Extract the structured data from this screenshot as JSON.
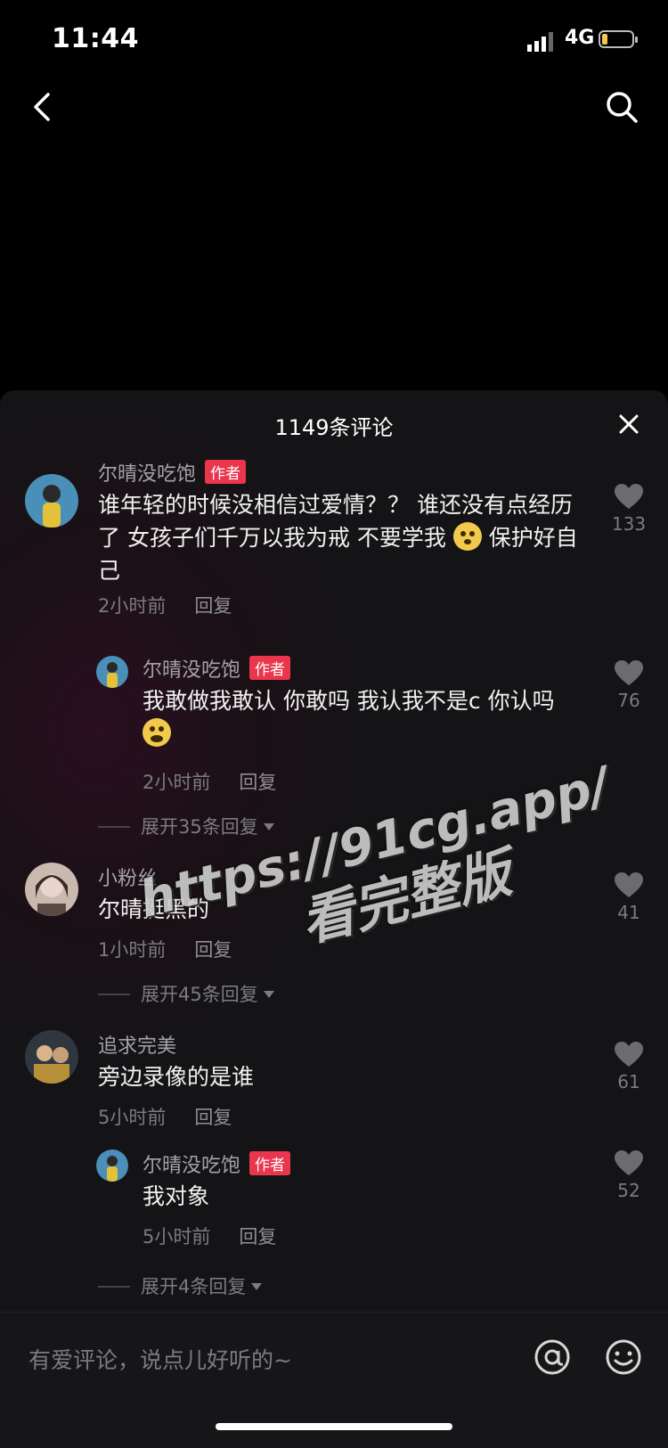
{
  "status": {
    "time": "11:44",
    "network": "4G"
  },
  "header": {
    "back_icon": "chevron-left-icon",
    "search_icon": "search-icon"
  },
  "sheet": {
    "title": "1149条评论",
    "close_icon": "close-icon"
  },
  "comments": [
    {
      "user": "尔晴没吃饱",
      "badge": "作者",
      "text_a": "谁年轻的时候没相信过爱情？？ 谁还没有点经历了 女孩子们千万以我为戒 不要学我 ",
      "text_b": "保护好自己",
      "emoji": "worried-face-emoji",
      "time": "2小时前",
      "reply_label": "回复",
      "likes": "133",
      "replies": [
        {
          "user": "尔晴没吃饱",
          "badge": "作者",
          "text": "我敢做我敢认 你敢吗 我认我不是c 你认吗",
          "emoji": "laughing-face-emoji",
          "time": "2小时前",
          "reply_label": "回复",
          "likes": "76"
        }
      ],
      "expand": "展开35条回复"
    },
    {
      "user": "小粉丝",
      "text": "尔晴挺黑的",
      "time": "1小时前",
      "reply_label": "回复",
      "likes": "41",
      "expand": "展开45条回复"
    },
    {
      "user": "追求完美",
      "text": "旁边录像的是谁",
      "time": "5小时前",
      "reply_label": "回复",
      "likes": "61",
      "replies": [
        {
          "user": "尔晴没吃饱",
          "badge": "作者",
          "text": "我对象",
          "time": "5小时前",
          "reply_label": "回复",
          "likes": "52"
        }
      ],
      "expand": "展开4条回复"
    }
  ],
  "watermark": {
    "line1": "https://91cg.app/",
    "line2": "看完整版"
  },
  "input": {
    "placeholder": "有爱评论，说点儿好听的~",
    "at_icon": "at-icon",
    "emoji_icon": "smiley-icon"
  },
  "colors": {
    "author_badge": "#e9364d",
    "background": "#000000",
    "sheet": "#151517"
  }
}
